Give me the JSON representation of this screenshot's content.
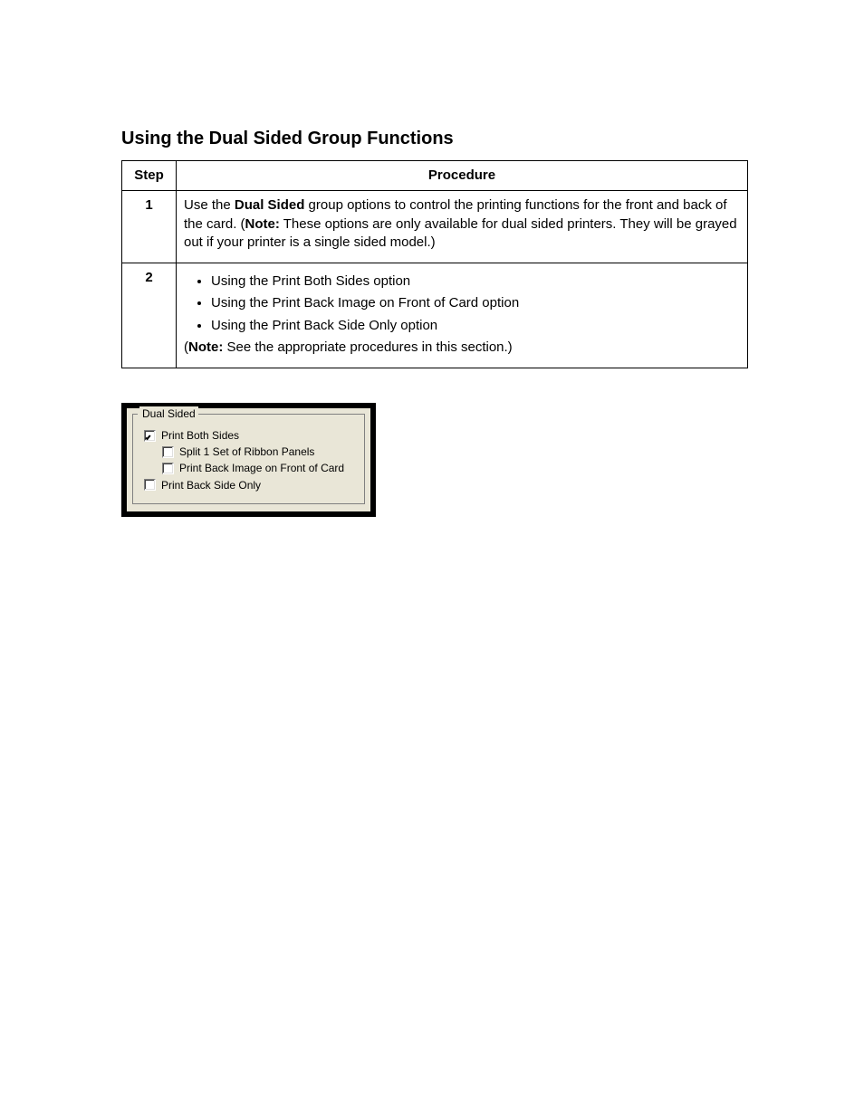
{
  "heading": "Using the Dual Sided Group Functions",
  "table": {
    "headers": {
      "step": "Step",
      "procedure": "Procedure"
    },
    "rows": [
      {
        "num": "1",
        "html_key": "row1",
        "text": "Use the Dual Sided group options to control the printing functions for the front and back of the card. (Note: These options are only available for dual sided printers. They will be grayed out if your printer is a single sided model.)"
      },
      {
        "num": "2",
        "html_key": "row2",
        "bullets": [
          "Using the Print Both Sides option",
          "Using the Print Back Image on Front of Card option",
          "Using the Print Back Side Only option"
        ],
        "note": "(Note: See the appropriate procedures in this section.)"
      }
    ]
  },
  "groupbox": {
    "title": "Dual Sided",
    "items": [
      {
        "label": "Print Both Sides",
        "checked": true,
        "indent": 0
      },
      {
        "label": "Split 1 Set of Ribbon Panels",
        "checked": false,
        "indent": 1
      },
      {
        "label": "Print Back Image on Front of Card",
        "checked": false,
        "indent": 1
      },
      {
        "label": "Print Back Side Only",
        "checked": false,
        "indent": 0
      }
    ]
  }
}
